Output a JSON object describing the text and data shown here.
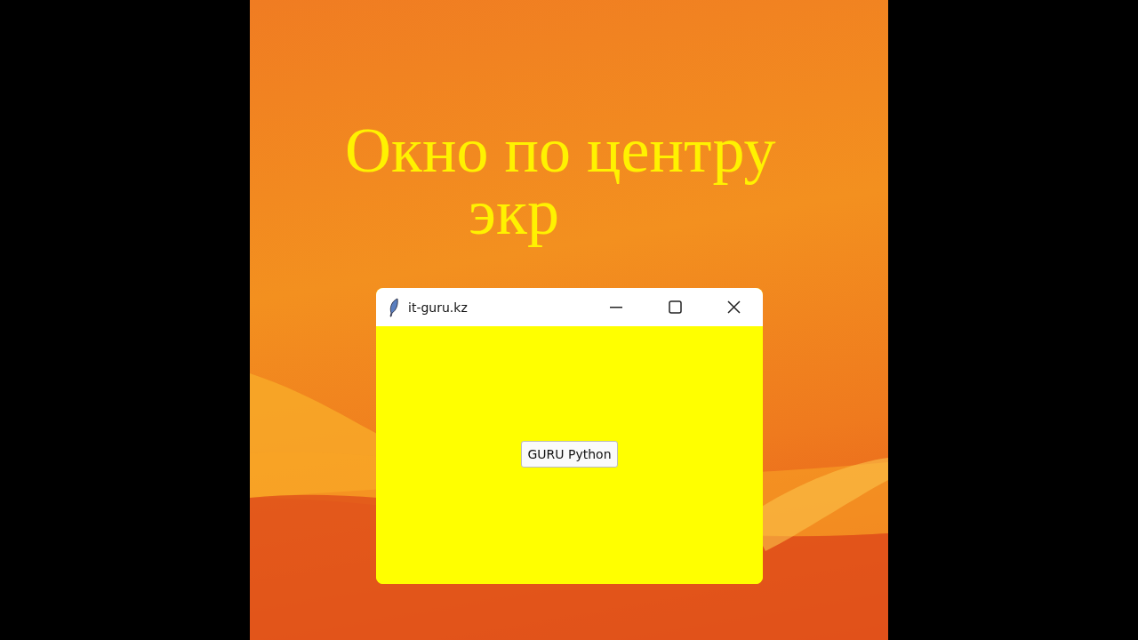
{
  "slide": {
    "heading_lines": [
      "Окно по центру",
      "экр"
    ]
  },
  "window": {
    "title": "it-guru.kz",
    "button": "GURU Python"
  }
}
